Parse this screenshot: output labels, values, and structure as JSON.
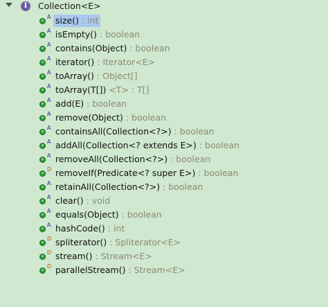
{
  "root": {
    "label": "Collection<E>",
    "icon": "interface-icon"
  },
  "members": [
    {
      "sig": "size()",
      "type": " : int",
      "mod": "A",
      "selected": true
    },
    {
      "sig": "isEmpty()",
      "type": " : boolean",
      "mod": "A"
    },
    {
      "sig": "contains(Object)",
      "type": " : boolean",
      "mod": "A"
    },
    {
      "sig": "iterator()",
      "type": " : Iterator<E>",
      "mod": "A"
    },
    {
      "sig": "toArray()",
      "type": " : Object[]",
      "mod": "A"
    },
    {
      "sig": "toArray(T[])",
      "type": " <T> : T[]",
      "mod": "A"
    },
    {
      "sig": "add(E)",
      "type": " : boolean",
      "mod": "A"
    },
    {
      "sig": "remove(Object)",
      "type": " : boolean",
      "mod": "A"
    },
    {
      "sig": "containsAll(Collection<?>)",
      "type": " : boolean",
      "mod": "A"
    },
    {
      "sig": "addAll(Collection<? extends E>)",
      "type": " : boolean",
      "mod": "A"
    },
    {
      "sig": "removeAll(Collection<?>)",
      "type": " : boolean",
      "mod": "A"
    },
    {
      "sig": "removeIf(Predicate<? super E>)",
      "type": " : boolean",
      "mod": "D"
    },
    {
      "sig": "retainAll(Collection<?>)",
      "type": " : boolean",
      "mod": "A"
    },
    {
      "sig": "clear()",
      "type": " : void",
      "mod": "A"
    },
    {
      "sig": "equals(Object)",
      "type": " : boolean",
      "mod": "A"
    },
    {
      "sig": "hashCode()",
      "type": " : int",
      "mod": "A"
    },
    {
      "sig": "spliterator()",
      "type": " : Spliterator<E>",
      "mod": "D"
    },
    {
      "sig": "stream()",
      "type": " : Stream<E>",
      "mod": "D"
    },
    {
      "sig": "parallelStream()",
      "type": " : Stream<E>",
      "mod": "D"
    }
  ],
  "colors": {
    "background": "#cfe8cf",
    "method_dot": "#2c9a35",
    "selection": "#a9c9ee"
  }
}
